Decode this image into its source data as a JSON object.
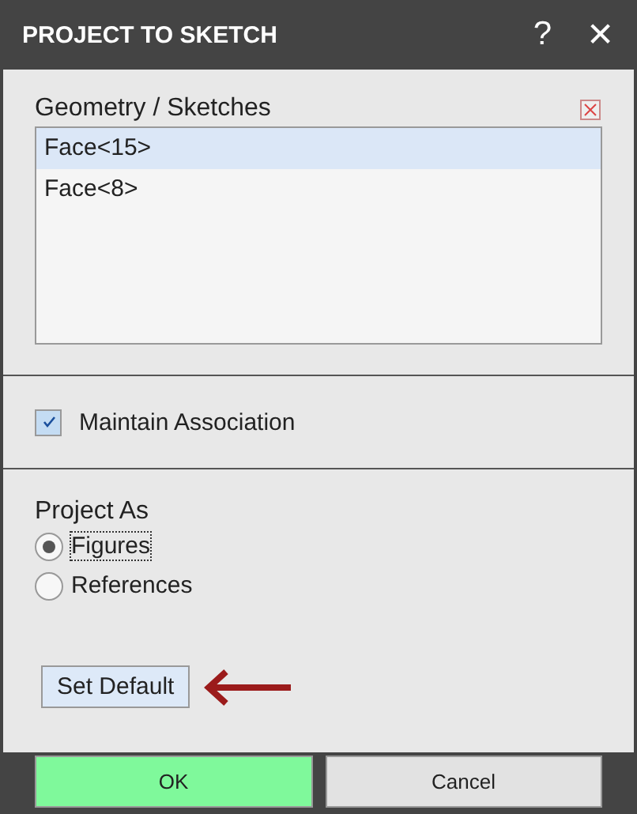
{
  "window": {
    "title": "PROJECT TO SKETCH",
    "help": "?",
    "close": "✕"
  },
  "geometry": {
    "label": "Geometry / Sketches",
    "items": [
      {
        "text": "Face<15>",
        "selected": true
      },
      {
        "text": "Face<8>",
        "selected": false
      }
    ]
  },
  "maintain_association": {
    "label": "Maintain Association",
    "checked": true
  },
  "project_as": {
    "label": "Project As",
    "options": [
      {
        "label": "Figures",
        "selected": true
      },
      {
        "label": "References",
        "selected": false
      }
    ]
  },
  "set_default": "Set Default",
  "buttons": [
    {
      "label": "OK",
      "kind": "primary"
    },
    {
      "label": "Cancel",
      "kind": "secondary"
    }
  ]
}
